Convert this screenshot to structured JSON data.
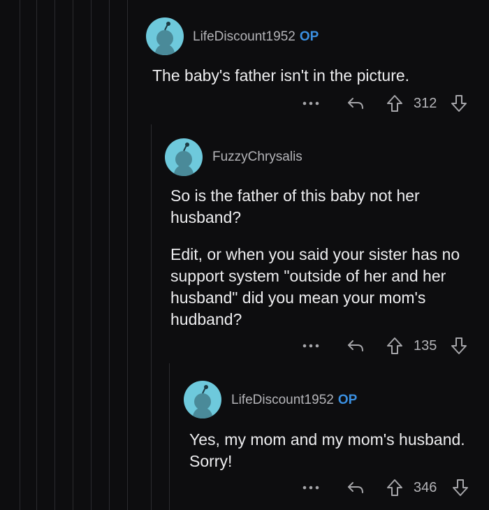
{
  "comments": [
    {
      "username": "LifeDiscount1952",
      "op_badge": "OP",
      "paragraphs": [
        "The baby's father isn't in the picture."
      ],
      "score": "312"
    },
    {
      "username": "FuzzyChrysalis",
      "op_badge": "",
      "paragraphs": [
        "So is the father of this baby not her husband?",
        "Edit, or when you said your sister has no support system \"outside of her and her husband\" did you mean your mom's hudband?"
      ],
      "score": "135"
    },
    {
      "username": "LifeDiscount1952",
      "op_badge": "OP",
      "paragraphs": [
        "Yes, my mom and my mom's husband. Sorry!"
      ],
      "score": "346"
    }
  ],
  "icons": {
    "more": "more-options-icon",
    "reply": "reply-icon",
    "upvote": "upvote-icon",
    "downvote": "downvote-icon",
    "avatar": "snoo-avatar-icon"
  },
  "colors": {
    "background": "#0d0d0f",
    "avatar": "#6ec9dc",
    "op_badge": "#3a8fe0",
    "text": "#ededef",
    "muted": "#b4b4b8"
  }
}
